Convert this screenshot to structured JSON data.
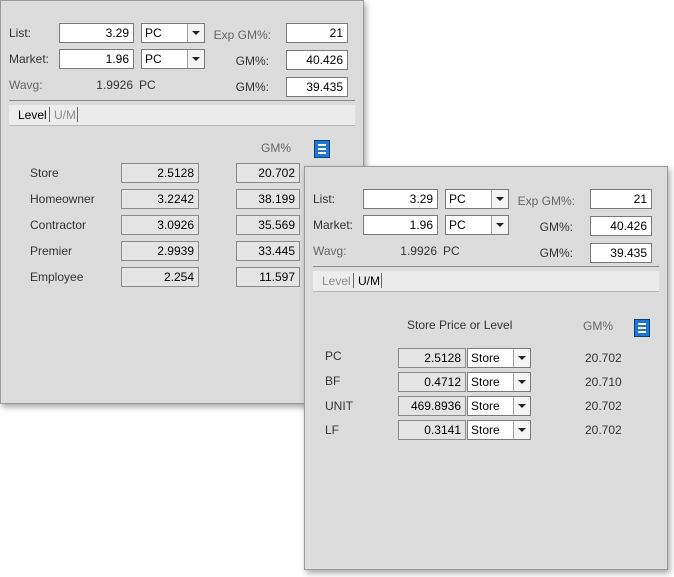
{
  "panel1": {
    "list_label": "List:",
    "list_value": "3.29",
    "list_unit": "PC",
    "market_label": "Market:",
    "market_value": "1.96",
    "market_unit": "PC",
    "wavg_label": "Wavg:",
    "wavg_value": "1.9926",
    "wavg_unit": "PC",
    "exp_gm_label": "Exp GM%:",
    "exp_gm_value": "21",
    "gm1_label": "GM%:",
    "gm1_value": "40.426",
    "gm2_label": "GM%:",
    "gm2_value": "39.435",
    "tabs": [
      {
        "label": "Level"
      },
      {
        "label": "U/M"
      }
    ],
    "active_tab": "Level",
    "gm_header": "GM%",
    "rows": [
      {
        "name": "Store",
        "price": "2.5128",
        "gm": "20.702"
      },
      {
        "name": "Homeowner",
        "price": "3.2242",
        "gm": "38.199"
      },
      {
        "name": "Contractor",
        "price": "3.0926",
        "gm": "35.569"
      },
      {
        "name": "Premier",
        "price": "2.9939",
        "gm": "33.445"
      },
      {
        "name": "Employee",
        "price": "2.254",
        "gm": "11.597"
      }
    ]
  },
  "panel2": {
    "list_label": "List:",
    "list_value": "3.29",
    "list_unit": "PC",
    "market_label": "Market:",
    "market_value": "1.96",
    "market_unit": "PC",
    "wavg_label": "Wavg:",
    "wavg_value": "1.9926",
    "wavg_unit": "PC",
    "exp_gm_label": "Exp GM%:",
    "exp_gm_value": "21",
    "gm1_label": "GM%:",
    "gm1_value": "40.426",
    "gm2_label": "GM%:",
    "gm2_value": "39.435",
    "tabs": [
      {
        "label": "Level"
      },
      {
        "label": "U/M"
      }
    ],
    "active_tab": "U/M",
    "price_header": "Store Price or Level",
    "gm_header": "GM%",
    "rows": [
      {
        "unit": "PC",
        "price": "2.5128",
        "level": "Store",
        "gm": "20.702"
      },
      {
        "unit": "BF",
        "price": "0.4712",
        "level": "Store",
        "gm": "20.710"
      },
      {
        "unit": "UNIT",
        "price": "469.8936",
        "level": "Store",
        "gm": "20.702"
      },
      {
        "unit": "LF",
        "price": "0.3141",
        "level": "Store",
        "gm": "20.702"
      }
    ]
  },
  "icons": {
    "menu": "menu-lines-icon",
    "dropdown": "chevron-down-icon"
  },
  "colors": {
    "panel_bg": "#dcdcdc",
    "menu_icon_blue": "#1e78d2"
  }
}
